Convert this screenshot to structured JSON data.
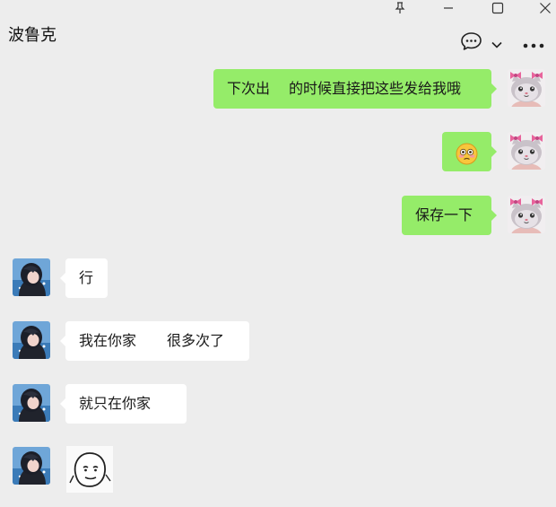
{
  "window": {
    "controls": [
      "pin-icon",
      "minimize-icon",
      "maximize-icon",
      "close-icon"
    ]
  },
  "header": {
    "title": "波鲁克",
    "icons": [
      "chat-bubble-icon",
      "chevron-down-icon",
      "more-icon"
    ]
  },
  "colors": {
    "background": "#ededed",
    "my_bubble": "#95ec69",
    "their_bubble": "#ffffff"
  },
  "messages": [
    {
      "sender": "me",
      "text_a": "下次出",
      "text_b": "的时候直接把这些发给我哦"
    },
    {
      "sender": "me",
      "kind": "emoji",
      "emoji": "flushed-face-emoji"
    },
    {
      "sender": "me",
      "text": "保存一下"
    },
    {
      "sender": "other",
      "text": "行"
    },
    {
      "sender": "other",
      "text_a": "我在你家",
      "text_b": "很多次了"
    },
    {
      "sender": "other",
      "text": "就只在你家"
    },
    {
      "sender": "other",
      "kind": "sticker",
      "sticker": "smiling-face-sticker"
    }
  ]
}
